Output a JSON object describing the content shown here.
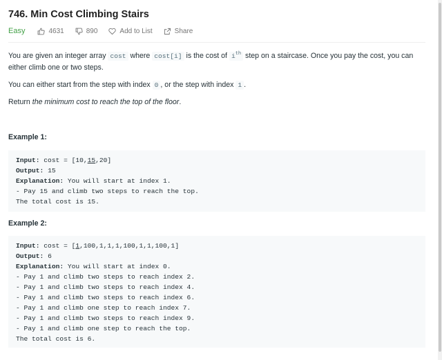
{
  "problem": {
    "title": "746. Min Cost Climbing Stairs",
    "difficulty": "Easy",
    "likes": "4631",
    "dislikes": "890",
    "add_to_list": "Add to List",
    "share": "Share"
  },
  "description": {
    "p1_a": "You are given an integer array ",
    "p1_code1": "cost",
    "p1_b": " where ",
    "p1_code2": "cost[i]",
    "p1_c": " is the cost of ",
    "p1_code3_base": "i",
    "p1_code3_sup": "th",
    "p1_d": " step on a staircase. Once you pay the cost, you can either climb one or two steps.",
    "p2_a": "You can either start from the step with index ",
    "p2_code1": "0",
    "p2_b": ", or the step with index ",
    "p2_code2": "1",
    "p2_c": ".",
    "p3_a": "Return ",
    "p3_em": "the minimum cost to reach the top of the floor",
    "p3_b": "."
  },
  "examples": [
    {
      "title": "Example 1:",
      "input_label": "Input:",
      "input_prefix": " cost = [10,",
      "input_hl": "15",
      "input_suffix": ",20]",
      "output_label": "Output:",
      "output_value": " 15",
      "explanation_label": "Explanation:",
      "explanation_text": " You will start at index 1.",
      "lines": [
        "- Pay 15 and climb two steps to reach the top.",
        "The total cost is 15."
      ]
    },
    {
      "title": "Example 2:",
      "input_label": "Input:",
      "input_prefix": " cost = [",
      "input_hl": "1",
      "input_suffix": ",100,1,1,1,100,1,1,100,1]",
      "output_label": "Output:",
      "output_value": " 6",
      "explanation_label": "Explanation:",
      "explanation_text": " You will start at index 0.",
      "lines": [
        "- Pay 1 and climb two steps to reach index 2.",
        "- Pay 1 and climb two steps to reach index 4.",
        "- Pay 1 and climb two steps to reach index 6.",
        "- Pay 1 and climb one step to reach index 7.",
        "- Pay 1 and climb two steps to reach index 9.",
        "- Pay 1 and climb one step to reach the top.",
        "The total cost is 6."
      ]
    }
  ],
  "icons": {
    "like": "thumbs-up-icon",
    "dislike": "thumbs-down-icon",
    "add_to_list": "heart-icon",
    "share": "share-icon"
  },
  "colors": {
    "easy": "#43a047",
    "meta": "#757575",
    "code_bg": "#f7f9fa"
  }
}
